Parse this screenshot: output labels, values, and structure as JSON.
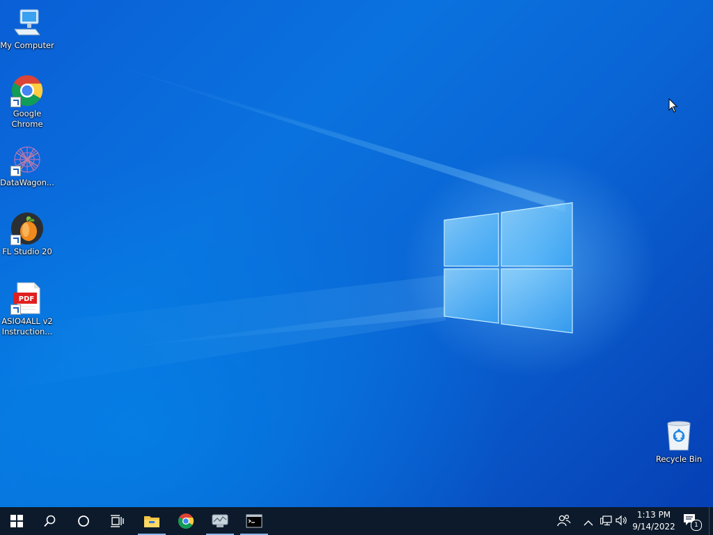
{
  "desktop": {
    "icons": [
      {
        "label": "My Computer",
        "icon": "computer-icon"
      },
      {
        "label": "Google Chrome",
        "icon": "chrome-icon"
      },
      {
        "label": "DataWagon...",
        "icon": "datawagon-icon"
      },
      {
        "label": "FL Studio 20",
        "icon": "fl-studio-icon"
      },
      {
        "label": "ASIO4ALL v2 Instruction...",
        "icon": "pdf-icon",
        "badge": "PDF"
      },
      {
        "label": "Recycle Bin",
        "icon": "recycle-bin-icon"
      }
    ]
  },
  "taskbar": {
    "items": [
      {
        "name": "start",
        "icon": "windows-start-icon"
      },
      {
        "name": "search",
        "icon": "search-icon"
      },
      {
        "name": "cortana",
        "icon": "cortana-circle-icon"
      },
      {
        "name": "task-view",
        "icon": "task-view-icon"
      },
      {
        "name": "file-explorer",
        "icon": "folder-icon",
        "active": true
      },
      {
        "name": "chrome",
        "icon": "chrome-icon"
      },
      {
        "name": "network-monitor",
        "icon": "monitor-app-icon",
        "active": true
      },
      {
        "name": "command-prompt",
        "icon": "terminal-icon",
        "active": true
      }
    ],
    "tray": {
      "people": "people-icon",
      "chevron": "chevron-up-icon",
      "network": "network-icon",
      "volume": "volume-icon",
      "time": "1:13 PM",
      "date": "9/14/2022",
      "notifications_count": "1"
    }
  },
  "colors": {
    "taskbar": "#0c1a2b",
    "desktop_accent": "#0a72de"
  }
}
